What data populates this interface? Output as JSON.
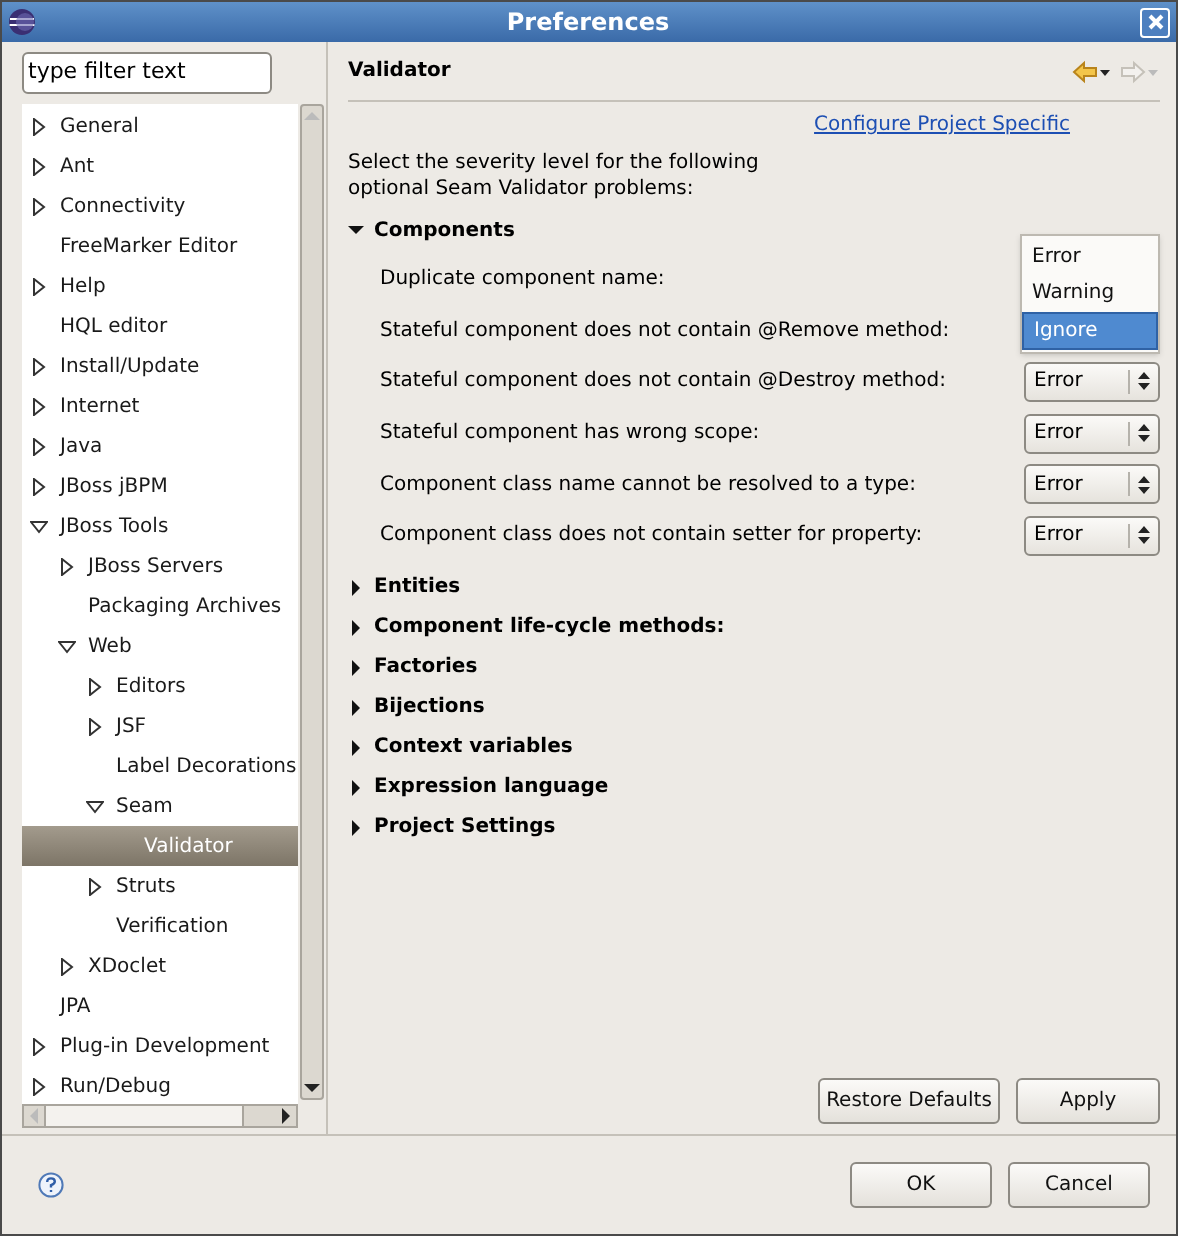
{
  "window": {
    "title": "Preferences"
  },
  "filter": {
    "value": "type filter text"
  },
  "tree": [
    {
      "label": "General",
      "expanded": false,
      "selected": false
    },
    {
      "label": "Ant",
      "expanded": false,
      "selected": false
    },
    {
      "label": "Connectivity",
      "expanded": false,
      "selected": false
    },
    {
      "label": "FreeMarker Editor",
      "selected": false
    },
    {
      "label": "Help",
      "expanded": false,
      "selected": false
    },
    {
      "label": "HQL editor",
      "selected": false
    },
    {
      "label": "Install/Update",
      "expanded": false,
      "selected": false
    },
    {
      "label": "Internet",
      "expanded": false,
      "selected": false
    },
    {
      "label": "Java",
      "expanded": false,
      "selected": false
    },
    {
      "label": "JBoss jBPM",
      "expanded": false,
      "selected": false
    },
    {
      "label": "JBoss Tools",
      "expanded": true,
      "selected": false,
      "children": [
        {
          "label": "JBoss Servers",
          "expanded": false,
          "selected": false
        },
        {
          "label": "Packaging Archives",
          "selected": false
        },
        {
          "label": "Web",
          "expanded": true,
          "selected": false,
          "children": [
            {
              "label": "Editors",
              "expanded": false,
              "selected": false
            },
            {
              "label": "JSF",
              "expanded": false,
              "selected": false
            },
            {
              "label": "Label Decorations",
              "selected": false
            },
            {
              "label": "Seam",
              "expanded": true,
              "selected": false,
              "children": [
                {
                  "label": "Validator",
                  "selected": true
                }
              ]
            },
            {
              "label": "Struts",
              "expanded": false,
              "selected": false
            },
            {
              "label": "Verification",
              "selected": false
            }
          ]
        },
        {
          "label": "XDoclet",
          "expanded": false,
          "selected": false
        }
      ]
    },
    {
      "label": "JPA",
      "selected": false
    },
    {
      "label": "Plug-in Development",
      "expanded": false,
      "selected": false
    },
    {
      "label": "Run/Debug",
      "expanded": false,
      "selected": false
    }
  ],
  "page": {
    "title": "Validator",
    "link": "Configure Project Specific",
    "description": "Select the severity level for the following optional Seam Validator problems:",
    "sections": [
      {
        "label": "Components",
        "expanded": true,
        "rows": [
          {
            "label": "Duplicate component name:"
          },
          {
            "label": "Stateful component does not contain @Remove method:"
          },
          {
            "label": "Stateful component does not contain @Destroy method:",
            "value": "Error"
          },
          {
            "label": "Stateful component has wrong scope:",
            "value": "Error"
          },
          {
            "label": "Component class name cannot be resolved to a type:",
            "value": "Error"
          },
          {
            "label": "Component class does not contain setter for property:",
            "value": "Error"
          }
        ],
        "popup": [
          {
            "label": "Error",
            "selected": false
          },
          {
            "label": "Warning",
            "selected": false
          },
          {
            "label": "Ignore",
            "selected": true
          }
        ]
      },
      {
        "label": "Entities",
        "expanded": false
      },
      {
        "label": "Component life-cycle methods:",
        "expanded": false
      },
      {
        "label": "Factories",
        "expanded": false
      },
      {
        "label": "Bijections",
        "expanded": false
      },
      {
        "label": "Context variables",
        "expanded": false
      },
      {
        "label": "Expression language",
        "expanded": false
      },
      {
        "label": "Project Settings",
        "expanded": false
      }
    ],
    "buttons": [
      "Restore Defaults",
      "Apply"
    ]
  },
  "footer": {
    "buttons": [
      "OK",
      "Cancel"
    ]
  }
}
